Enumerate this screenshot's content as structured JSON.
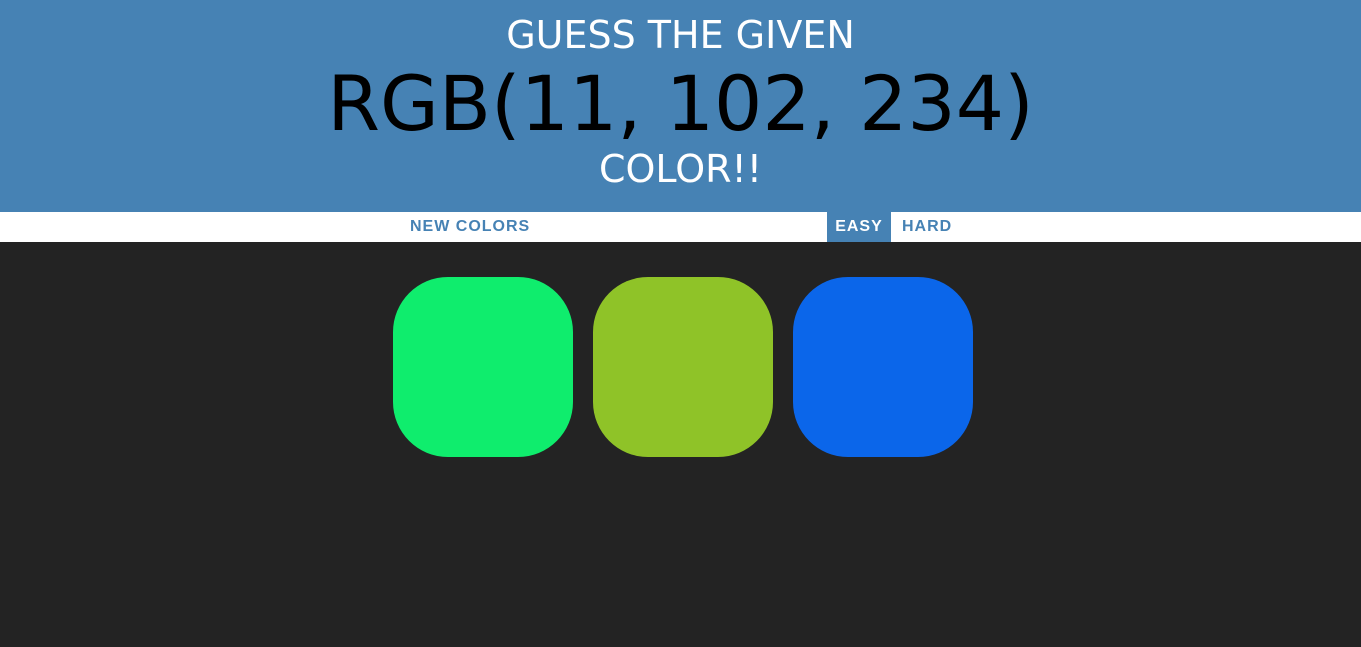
{
  "header": {
    "line1": "GUESS THE GIVEN",
    "rgb_display": "RGB(11, 102, 234)",
    "line3": "COLOR!!"
  },
  "controls": {
    "new_colors_label": "NEW COLORS",
    "easy_label": "EASY",
    "hard_label": "HARD",
    "selected_mode": "EASY"
  },
  "squares": [
    {
      "color": "#0fed6d"
    },
    {
      "color": "#8fc328"
    },
    {
      "color": "#0b66ea"
    }
  ],
  "colors": {
    "header_bg": "#4682b4",
    "body_bg": "#232323",
    "stripe_bg": "#ffffff",
    "accent": "#4682b4"
  }
}
